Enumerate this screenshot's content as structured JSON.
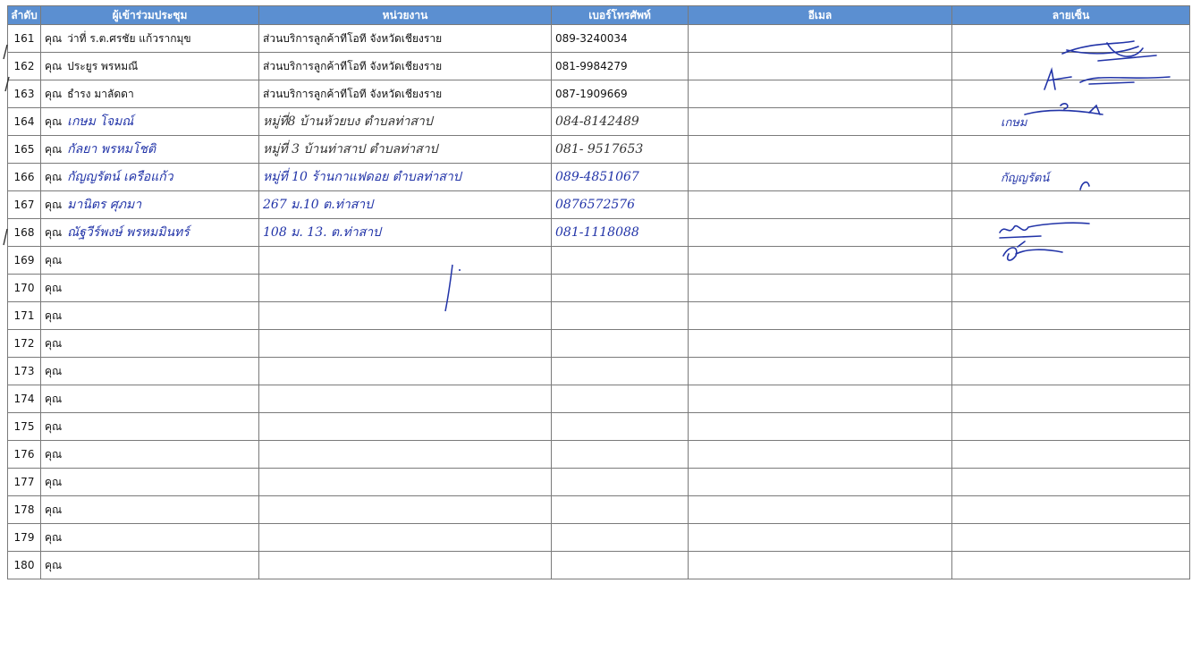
{
  "headers": {
    "no": "ลำดับ",
    "participant": "ผู้เข้าร่วมประชุม",
    "agency": "หน่วยงาน",
    "phone": "เบอร์โทรศัพท์",
    "email": "อีเมล",
    "signature": "ลายเซ็น"
  },
  "rows": [
    {
      "no": "161",
      "prefix": "คุณ",
      "name": "ว่าที่ ร.ต.ศรชัย  แก้วรากมุข",
      "agency": "ส่วนบริการลูกค้าทีโอที จังหวัดเชียงราย",
      "phone": "089-3240034",
      "email": "",
      "signature": ""
    },
    {
      "no": "162",
      "prefix": "คุณ",
      "name": "ประยูร  พรหมณี",
      "agency": "ส่วนบริการลูกค้าทีโอที จังหวัดเชียงราย",
      "phone": "081-9984279",
      "email": "",
      "signature": ""
    },
    {
      "no": "163",
      "prefix": "คุณ",
      "name": "ธำรง  มาลัดดา",
      "agency": "ส่วนบริการลูกค้าทีโอที จังหวัดเชียงราย",
      "phone": "087-1909669",
      "email": "",
      "signature": ""
    },
    {
      "no": "164",
      "prefix": "คุณ",
      "name": "เกษม  โจมณ์",
      "agency": "หมู่ที่8  บ้านห้วยบง  ตำบลท่าสาป",
      "phone": "084-8142489",
      "email": "",
      "signature": "เกษม"
    },
    {
      "no": "165",
      "prefix": "คุณ",
      "name": "กัลยา  พรหมโชติ",
      "agency": "หมู่ที่ 3  บ้านท่าสาป  ตำบลท่าสาป",
      "phone": "081- 9517653",
      "email": "",
      "signature": ""
    },
    {
      "no": "166",
      "prefix": "คุณ",
      "name": "กัญญรัตน์  เครือแก้ว",
      "agency": "หมู่ที่ 10  ร้านกาแฟดอย  ตำบลท่าสาป",
      "phone": "089-4851067",
      "email": "",
      "signature": "กัญญรัตน์"
    },
    {
      "no": "167",
      "prefix": "คุณ",
      "name": "มานิตร  ศุภมา",
      "agency": "267  ม.10  ต.ท่าสาป",
      "phone": "0876572576",
      "email": "",
      "signature": ""
    },
    {
      "no": "168",
      "prefix": "คุณ",
      "name": "ณัฐวีร์พงษ์  พรหมมินทร์",
      "agency": "108  ม. 13.  ต.ท่าสาป",
      "phone": "081-1118088",
      "email": "",
      "signature": ""
    },
    {
      "no": "169",
      "prefix": "คุณ",
      "name": "",
      "agency": "",
      "phone": "",
      "email": "",
      "signature": ""
    },
    {
      "no": "170",
      "prefix": "คุณ",
      "name": "",
      "agency": "",
      "phone": "",
      "email": "",
      "signature": ""
    },
    {
      "no": "171",
      "prefix": "คุณ",
      "name": "",
      "agency": "",
      "phone": "",
      "email": "",
      "signature": ""
    },
    {
      "no": "172",
      "prefix": "คุณ",
      "name": "",
      "agency": "",
      "phone": "",
      "email": "",
      "signature": ""
    },
    {
      "no": "173",
      "prefix": "คุณ",
      "name": "",
      "agency": "",
      "phone": "",
      "email": "",
      "signature": ""
    },
    {
      "no": "174",
      "prefix": "คุณ",
      "name": "",
      "agency": "",
      "phone": "",
      "email": "",
      "signature": ""
    },
    {
      "no": "175",
      "prefix": "คุณ",
      "name": "",
      "agency": "",
      "phone": "",
      "email": "",
      "signature": ""
    },
    {
      "no": "176",
      "prefix": "คุณ",
      "name": "",
      "agency": "",
      "phone": "",
      "email": "",
      "signature": ""
    },
    {
      "no": "177",
      "prefix": "คุณ",
      "name": "",
      "agency": "",
      "phone": "",
      "email": "",
      "signature": ""
    },
    {
      "no": "178",
      "prefix": "คุณ",
      "name": "",
      "agency": "",
      "phone": "",
      "email": "",
      "signature": ""
    },
    {
      "no": "179",
      "prefix": "คุณ",
      "name": "",
      "agency": "",
      "phone": "",
      "email": "",
      "signature": ""
    },
    {
      "no": "180",
      "prefix": "คุณ",
      "name": "",
      "agency": "",
      "phone": "",
      "email": "",
      "signature": ""
    }
  ],
  "colors": {
    "header_bg": "#5b8fd1",
    "ink_blue": "#2234a8",
    "grid": "#7a7a7a"
  }
}
